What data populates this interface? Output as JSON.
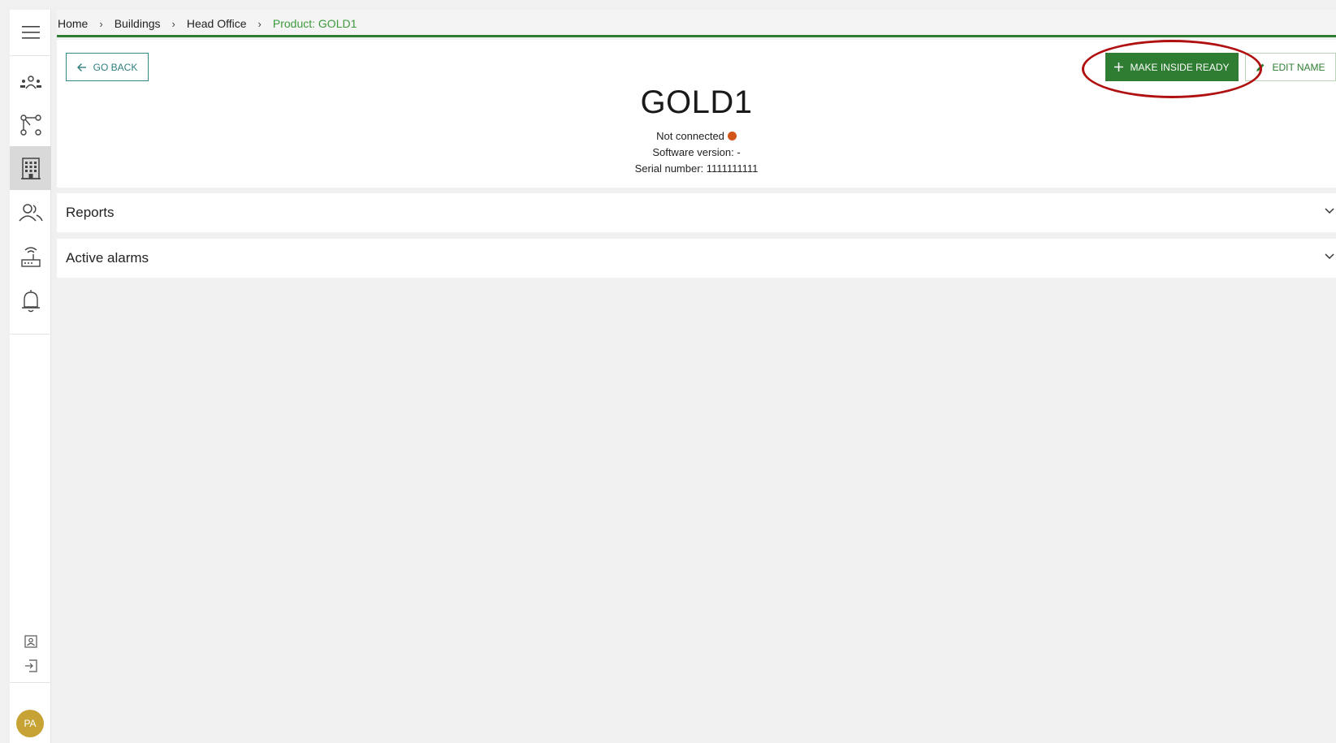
{
  "breadcrumb": {
    "home": "Home",
    "buildings": "Buildings",
    "head_office": "Head Office",
    "current": "Product: GOLD1",
    "separator": "›"
  },
  "sidebar": {
    "items": [
      {
        "icon": "menu-icon"
      },
      {
        "icon": "users-group-icon"
      },
      {
        "icon": "network-nodes-icon"
      },
      {
        "icon": "building-icon",
        "active": true
      },
      {
        "icon": "person-group-icon"
      },
      {
        "icon": "router-icon"
      },
      {
        "icon": "bell-icon"
      }
    ],
    "bottom": [
      {
        "icon": "profile-card-icon"
      },
      {
        "icon": "logout-icon"
      }
    ],
    "avatar_initials": "PA"
  },
  "actions": {
    "go_back": "GO BACK",
    "make_inside_ready": "MAKE INSIDE READY",
    "edit_name": "EDIT NAME"
  },
  "product": {
    "name": "GOLD1",
    "connection_status": "Not connected",
    "software_version": "Software version: -",
    "serial_number": "Serial number: 1111111111"
  },
  "sections": {
    "reports": "Reports",
    "active_alarms": "Active alarms"
  },
  "colors": {
    "brand_green": "#2e7d32",
    "status_disconnected": "#d2551a",
    "highlight_ring": "#b01010",
    "avatar": "#c7a335"
  }
}
